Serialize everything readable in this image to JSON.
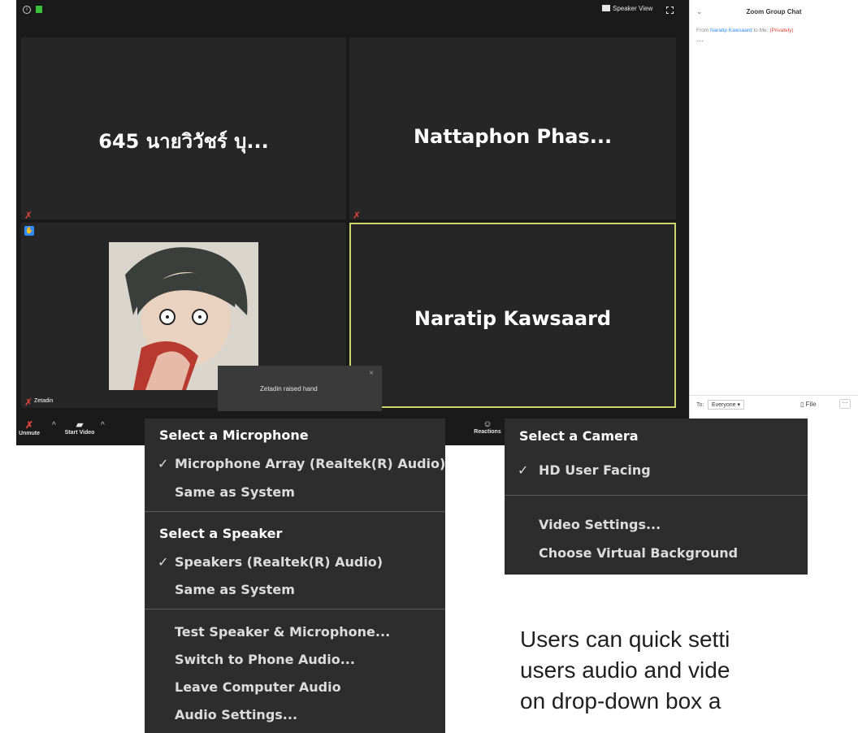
{
  "topbar": {
    "speaker_view_label": "Speaker View"
  },
  "tiles": [
    {
      "name": "645 นายวิวัชร์ บุ..."
    },
    {
      "name": "Nattaphon  Phas..."
    },
    {
      "name": "Zetadin"
    },
    {
      "name": "Naratip Kawsaard"
    }
  ],
  "notification": {
    "text": "Zetadin raised hand"
  },
  "toolbar": {
    "unmute_label": "Unmute",
    "start_video_label": "Start Video",
    "reactions_label": "Reactions"
  },
  "chat": {
    "title": "Zoom Group Chat",
    "meta_from": "From",
    "meta_sender": "Naratip Kawsaard",
    "meta_to": "to Me:",
    "meta_private": "(Privately)",
    "message": "....",
    "to_label": "To:",
    "to_value": "Everyone",
    "file_label": "File"
  },
  "audio_menu": {
    "mic_header": "Select a Microphone",
    "mic_items": [
      "Microphone Array (Realtek(R) Audio)",
      "Same as System"
    ],
    "speaker_header": "Select a Speaker",
    "speaker_items": [
      "Speakers (Realtek(R) Audio)",
      "Same as System"
    ],
    "actions": [
      "Test Speaker & Microphone...",
      "Switch to Phone Audio...",
      "Leave Computer Audio",
      "Audio Settings..."
    ]
  },
  "camera_menu": {
    "header": "Select a Camera",
    "items": [
      "HD User Facing"
    ],
    "actions": [
      "Video Settings...",
      "Choose Virtual Background"
    ]
  },
  "caption": {
    "lines": [
      "Users can quick setti",
      "users audio and vide",
      "on drop-down box a"
    ]
  },
  "colors": {
    "active_speaker_border": "#c9d66b",
    "muted_red": "#e0453a",
    "link_blue": "#2d8cff",
    "private_red": "#e0453a"
  }
}
